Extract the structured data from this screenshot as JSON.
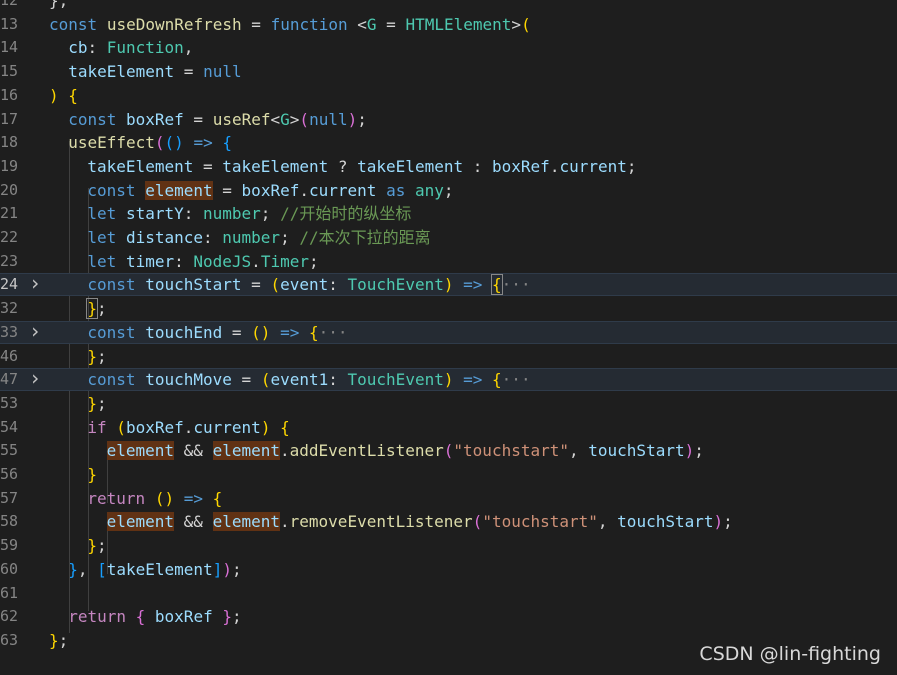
{
  "watermark": "CSDN @lin-fighting",
  "lines": [
    {
      "n": "12",
      "tokens": [
        [
          "pn",
          "};"
        ]
      ]
    },
    {
      "n": "13",
      "tokens": [
        [
          "kw",
          "const"
        ],
        [
          "pn",
          " "
        ],
        [
          "fn",
          "useDownRefresh"
        ],
        [
          "pn",
          " = "
        ],
        [
          "kw",
          "function"
        ],
        [
          "pn",
          " <"
        ],
        [
          "type",
          "G"
        ],
        [
          "pn",
          " = "
        ],
        [
          "type",
          "HTMLElement"
        ],
        [
          "pn",
          ">"
        ],
        [
          "b1",
          "("
        ]
      ]
    },
    {
      "n": "14",
      "tokens": [
        [
          "var",
          "cb"
        ],
        [
          "pn",
          ": "
        ],
        [
          "type",
          "Function"
        ],
        [
          "pn",
          ","
        ]
      ]
    },
    {
      "n": "15",
      "tokens": [
        [
          "var",
          "takeElement"
        ],
        [
          "pn",
          " = "
        ],
        [
          "kw",
          "null"
        ]
      ]
    },
    {
      "n": "16",
      "tokens": [
        [
          "b1",
          ")"
        ],
        [
          "pn",
          " "
        ],
        [
          "b1",
          "{"
        ]
      ]
    },
    {
      "n": "17",
      "tokens": [
        [
          "kw",
          "const"
        ],
        [
          "pn",
          " "
        ],
        [
          "var",
          "boxRef"
        ],
        [
          "pn",
          " = "
        ],
        [
          "fn",
          "useRef"
        ],
        [
          "pn",
          "<"
        ],
        [
          "type",
          "G"
        ],
        [
          "pn",
          ">"
        ],
        [
          "b2",
          "("
        ],
        [
          "kw",
          "null"
        ],
        [
          "b2",
          ")"
        ],
        [
          "pn",
          ";"
        ]
      ]
    },
    {
      "n": "18",
      "tokens": [
        [
          "fn",
          "useEffect"
        ],
        [
          "b2",
          "("
        ],
        [
          "b3",
          "()"
        ],
        [
          "pn",
          " "
        ],
        [
          "kw",
          "=>"
        ],
        [
          "pn",
          " "
        ],
        [
          "b3",
          "{"
        ]
      ]
    },
    {
      "n": "19",
      "tokens": [
        [
          "var",
          "takeElement"
        ],
        [
          "pn",
          " = "
        ],
        [
          "var",
          "takeElement"
        ],
        [
          "pn",
          " ? "
        ],
        [
          "var",
          "takeElement"
        ],
        [
          "pn",
          " : "
        ],
        [
          "var",
          "boxRef"
        ],
        [
          "pn",
          "."
        ],
        [
          "var",
          "current"
        ],
        [
          "pn",
          ";"
        ]
      ]
    },
    {
      "n": "20",
      "tokens": [
        [
          "kw",
          "const"
        ],
        [
          "pn",
          " "
        ],
        [
          "occ",
          "element"
        ],
        [
          "pn",
          " = "
        ],
        [
          "var",
          "boxRef"
        ],
        [
          "pn",
          "."
        ],
        [
          "var",
          "current"
        ],
        [
          "pn",
          " "
        ],
        [
          "kw",
          "as"
        ],
        [
          "pn",
          " "
        ],
        [
          "type",
          "any"
        ],
        [
          "pn",
          ";"
        ]
      ]
    },
    {
      "n": "21",
      "tokens": [
        [
          "kw",
          "let"
        ],
        [
          "pn",
          " "
        ],
        [
          "var",
          "startY"
        ],
        [
          "pn",
          ": "
        ],
        [
          "type",
          "number"
        ],
        [
          "pn",
          "; "
        ],
        [
          "cmt",
          "//开始时的纵坐标"
        ]
      ]
    },
    {
      "n": "22",
      "tokens": [
        [
          "kw",
          "let"
        ],
        [
          "pn",
          " "
        ],
        [
          "var",
          "distance"
        ],
        [
          "pn",
          ": "
        ],
        [
          "type",
          "number"
        ],
        [
          "pn",
          "; "
        ],
        [
          "cmt",
          "//本次下拉的距离"
        ]
      ]
    },
    {
      "n": "23",
      "tokens": [
        [
          "kw",
          "let"
        ],
        [
          "pn",
          " "
        ],
        [
          "var",
          "timer"
        ],
        [
          "pn",
          ": "
        ],
        [
          "type",
          "NodeJS"
        ],
        [
          "pn",
          "."
        ],
        [
          "type",
          "Timer"
        ],
        [
          "pn",
          ";"
        ]
      ]
    },
    {
      "n": "24",
      "fold": true,
      "active": true,
      "hl": true,
      "tokens": [
        [
          "kw",
          "const"
        ],
        [
          "pn",
          " "
        ],
        [
          "var",
          "touchStart"
        ],
        [
          "pn",
          " = "
        ],
        [
          "b1",
          "("
        ],
        [
          "var",
          "event"
        ],
        [
          "pn",
          ": "
        ],
        [
          "type",
          "TouchEvent"
        ],
        [
          "b1",
          ")"
        ],
        [
          "pn",
          " "
        ],
        [
          "kw",
          "=>"
        ],
        [
          "pn",
          " "
        ],
        [
          "brk",
          "{"
        ],
        [
          "dots",
          "···"
        ]
      ]
    },
    {
      "n": "32",
      "tokens": [
        [
          "brk",
          "}"
        ],
        [
          "pn",
          ";"
        ]
      ]
    },
    {
      "n": "33",
      "fold": true,
      "hl": true,
      "tokens": [
        [
          "kw",
          "const"
        ],
        [
          "pn",
          " "
        ],
        [
          "var",
          "touchEnd"
        ],
        [
          "pn",
          " = "
        ],
        [
          "b1",
          "()"
        ],
        [
          "pn",
          " "
        ],
        [
          "kw",
          "=>"
        ],
        [
          "pn",
          " "
        ],
        [
          "b1",
          "{"
        ],
        [
          "dots",
          "···"
        ]
      ]
    },
    {
      "n": "46",
      "tokens": [
        [
          "b1",
          "}"
        ],
        [
          "pn",
          ";"
        ]
      ]
    },
    {
      "n": "47",
      "fold": true,
      "hl": true,
      "tokens": [
        [
          "kw",
          "const"
        ],
        [
          "pn",
          " "
        ],
        [
          "var",
          "touchMove"
        ],
        [
          "pn",
          " = "
        ],
        [
          "b1",
          "("
        ],
        [
          "var",
          "event1"
        ],
        [
          "pn",
          ": "
        ],
        [
          "type",
          "TouchEvent"
        ],
        [
          "b1",
          ")"
        ],
        [
          "pn",
          " "
        ],
        [
          "kw",
          "=>"
        ],
        [
          "pn",
          " "
        ],
        [
          "b1",
          "{"
        ],
        [
          "dots",
          "···"
        ]
      ]
    },
    {
      "n": "53",
      "tokens": [
        [
          "b1",
          "}"
        ],
        [
          "pn",
          ";"
        ]
      ]
    },
    {
      "n": "54",
      "tokens": [
        [
          "ctl",
          "if"
        ],
        [
          "pn",
          " "
        ],
        [
          "b1",
          "("
        ],
        [
          "var",
          "boxRef"
        ],
        [
          "pn",
          "."
        ],
        [
          "var",
          "current"
        ],
        [
          "b1",
          ")"
        ],
        [
          "pn",
          " "
        ],
        [
          "b1",
          "{"
        ]
      ]
    },
    {
      "n": "55",
      "tokens": [
        [
          "occ",
          "element"
        ],
        [
          "pn",
          " && "
        ],
        [
          "occ",
          "element"
        ],
        [
          "pn",
          "."
        ],
        [
          "fn",
          "addEventListener"
        ],
        [
          "b2",
          "("
        ],
        [
          "str",
          "\"touchstart\""
        ],
        [
          "pn",
          ", "
        ],
        [
          "var",
          "touchStart"
        ],
        [
          "b2",
          ")"
        ],
        [
          "pn",
          ";"
        ]
      ]
    },
    {
      "n": "56",
      "tokens": [
        [
          "b1",
          "}"
        ]
      ]
    },
    {
      "n": "57",
      "tokens": [
        [
          "ctl",
          "return"
        ],
        [
          "pn",
          " "
        ],
        [
          "b1",
          "()"
        ],
        [
          "pn",
          " "
        ],
        [
          "kw",
          "=>"
        ],
        [
          "pn",
          " "
        ],
        [
          "b1",
          "{"
        ]
      ]
    },
    {
      "n": "58",
      "tokens": [
        [
          "occ",
          "element"
        ],
        [
          "pn",
          " && "
        ],
        [
          "occ",
          "element"
        ],
        [
          "pn",
          "."
        ],
        [
          "fn",
          "removeEventListener"
        ],
        [
          "b2",
          "("
        ],
        [
          "str",
          "\"touchstart\""
        ],
        [
          "pn",
          ", "
        ],
        [
          "var",
          "touchStart"
        ],
        [
          "b2",
          ")"
        ],
        [
          "pn",
          ";"
        ]
      ]
    },
    {
      "n": "59",
      "tokens": [
        [
          "b1",
          "}"
        ],
        [
          "pn",
          ";"
        ]
      ]
    },
    {
      "n": "60",
      "tokens": [
        [
          "b3",
          "}"
        ],
        [
          "pn",
          ", "
        ],
        [
          "b3",
          "["
        ],
        [
          "var",
          "takeElement"
        ],
        [
          "b3",
          "]"
        ],
        [
          "b2",
          ")"
        ],
        [
          "pn",
          ";"
        ]
      ]
    },
    {
      "n": "61",
      "tokens": []
    },
    {
      "n": "62",
      "tokens": [
        [
          "ctl",
          "return"
        ],
        [
          "pn",
          " "
        ],
        [
          "b2",
          "{"
        ],
        [
          "pn",
          " "
        ],
        [
          "var",
          "boxRef"
        ],
        [
          "pn",
          " "
        ],
        [
          "b2",
          "}"
        ],
        [
          "pn",
          ";"
        ]
      ]
    },
    {
      "n": "63",
      "tokens": [
        [
          "b1",
          "}"
        ],
        [
          "pn",
          ";"
        ]
      ]
    }
  ]
}
